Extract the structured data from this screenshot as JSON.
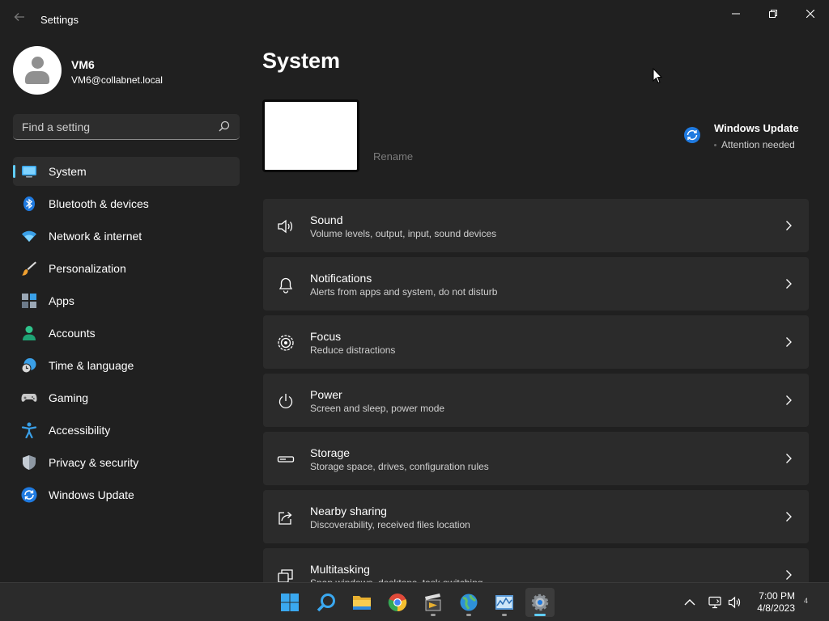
{
  "window": {
    "title": "Settings"
  },
  "user": {
    "name": "VM6",
    "email": "VM6@collabnet.local"
  },
  "search": {
    "placeholder": "Find a setting"
  },
  "sidebar": {
    "items": [
      {
        "label": "System",
        "icon": "monitor-icon",
        "selected": true
      },
      {
        "label": "Bluetooth & devices",
        "icon": "bluetooth-icon"
      },
      {
        "label": "Network & internet",
        "icon": "wifi-icon"
      },
      {
        "label": "Personalization",
        "icon": "brush-icon"
      },
      {
        "label": "Apps",
        "icon": "apps-icon"
      },
      {
        "label": "Accounts",
        "icon": "person-icon"
      },
      {
        "label": "Time & language",
        "icon": "globe-clock-icon"
      },
      {
        "label": "Gaming",
        "icon": "gamepad-icon"
      },
      {
        "label": "Accessibility",
        "icon": "accessibility-icon"
      },
      {
        "label": "Privacy & security",
        "icon": "shield-icon"
      },
      {
        "label": "Windows Update",
        "icon": "update-icon"
      }
    ]
  },
  "main": {
    "title": "System",
    "rename_label": "Rename",
    "windows_update": {
      "title": "Windows Update",
      "status": "Attention needed"
    },
    "cards": [
      {
        "title": "Sound",
        "desc": "Volume levels, output, input, sound devices",
        "icon": "speaker-icon"
      },
      {
        "title": "Notifications",
        "desc": "Alerts from apps and system, do not disturb",
        "icon": "bell-icon"
      },
      {
        "title": "Focus",
        "desc": "Reduce distractions",
        "icon": "focus-icon"
      },
      {
        "title": "Power",
        "desc": "Screen and sleep, power mode",
        "icon": "power-icon"
      },
      {
        "title": "Storage",
        "desc": "Storage space, drives, configuration rules",
        "icon": "storage-icon"
      },
      {
        "title": "Nearby sharing",
        "desc": "Discoverability, received files location",
        "icon": "share-icon"
      },
      {
        "title": "Multitasking",
        "desc": "Snap windows, desktops, task switching",
        "icon": "multitasking-icon"
      }
    ]
  },
  "taskbar": {
    "time": "7:00 PM",
    "date": "4/8/2023",
    "notification_count": "4"
  },
  "colors": {
    "accent": "#60cdff",
    "background": "#202020",
    "card": "#2b2b2b"
  }
}
